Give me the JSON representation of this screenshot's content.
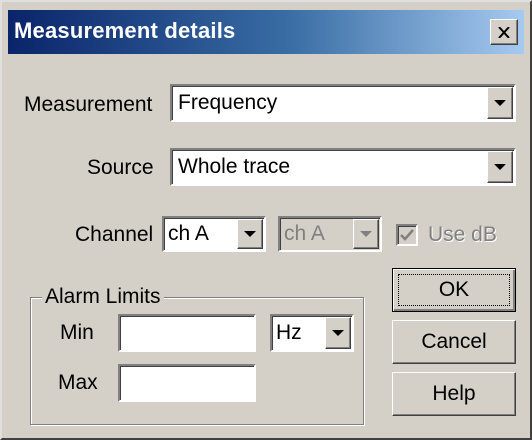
{
  "window": {
    "title": "Measurement details"
  },
  "measurement": {
    "label": "Measurement",
    "value": "Frequency"
  },
  "source": {
    "label": "Source",
    "value": "Whole trace"
  },
  "channel": {
    "label": "Channel",
    "value_primary": "ch A",
    "value_secondary": "ch A"
  },
  "use_db": {
    "label": "Use dB",
    "checked": true,
    "enabled": false
  },
  "alarm_limits": {
    "title": "Alarm Limits",
    "min_label": "Min",
    "min_value": "",
    "max_label": "Max",
    "max_value": "",
    "unit": "Hz"
  },
  "buttons": {
    "ok": "OK",
    "cancel": "Cancel",
    "help": "Help"
  }
}
